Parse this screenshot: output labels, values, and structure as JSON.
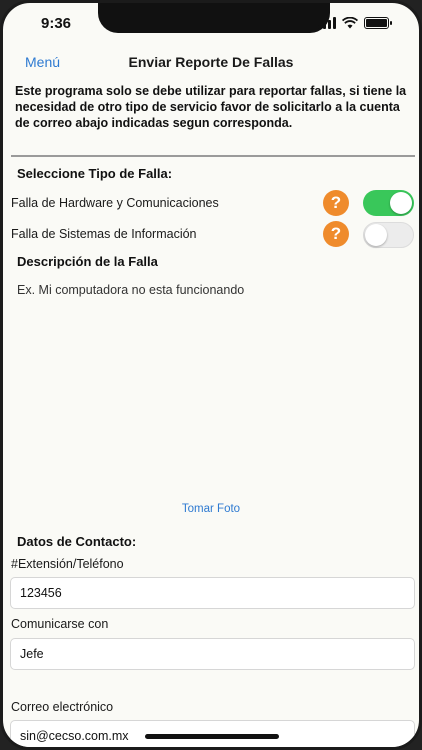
{
  "status_bar": {
    "time": "9:36"
  },
  "nav": {
    "menu_label": "Menú",
    "title": "Enviar Reporte De Fallas"
  },
  "intro_text": "Este programa solo se debe utilizar para reportar fallas, si tiene la necesidad de otro tipo de servicio favor de solicitarlo a la cuenta de correo abajo indicadas segun corresponda.",
  "fault_type": {
    "heading": "Seleccione Tipo de Falla:",
    "options": [
      {
        "label": "Falla de Hardware y Comunicaciones",
        "help": "?",
        "enabled": true
      },
      {
        "label": "Falla de Sistemas de Información",
        "help": "?",
        "enabled": false
      }
    ]
  },
  "description": {
    "heading": "Descripción de la Falla",
    "placeholder": "Ex. Mi computadora no esta funcionando"
  },
  "photo_link": "Tomar Foto",
  "contact": {
    "heading": "Datos de Contacto:",
    "extension_label": "#Extensión/Teléfono",
    "extension_value": "123456",
    "contact_with_label": "Comunicarse con",
    "contact_with_value": "Jefe",
    "email_label": "Correo electrónico",
    "email_value": "sin@cecso.com.mx"
  },
  "colors": {
    "accent": "#2e7ad1",
    "toggle_on": "#39c75a",
    "help": "#ef8b2c"
  }
}
